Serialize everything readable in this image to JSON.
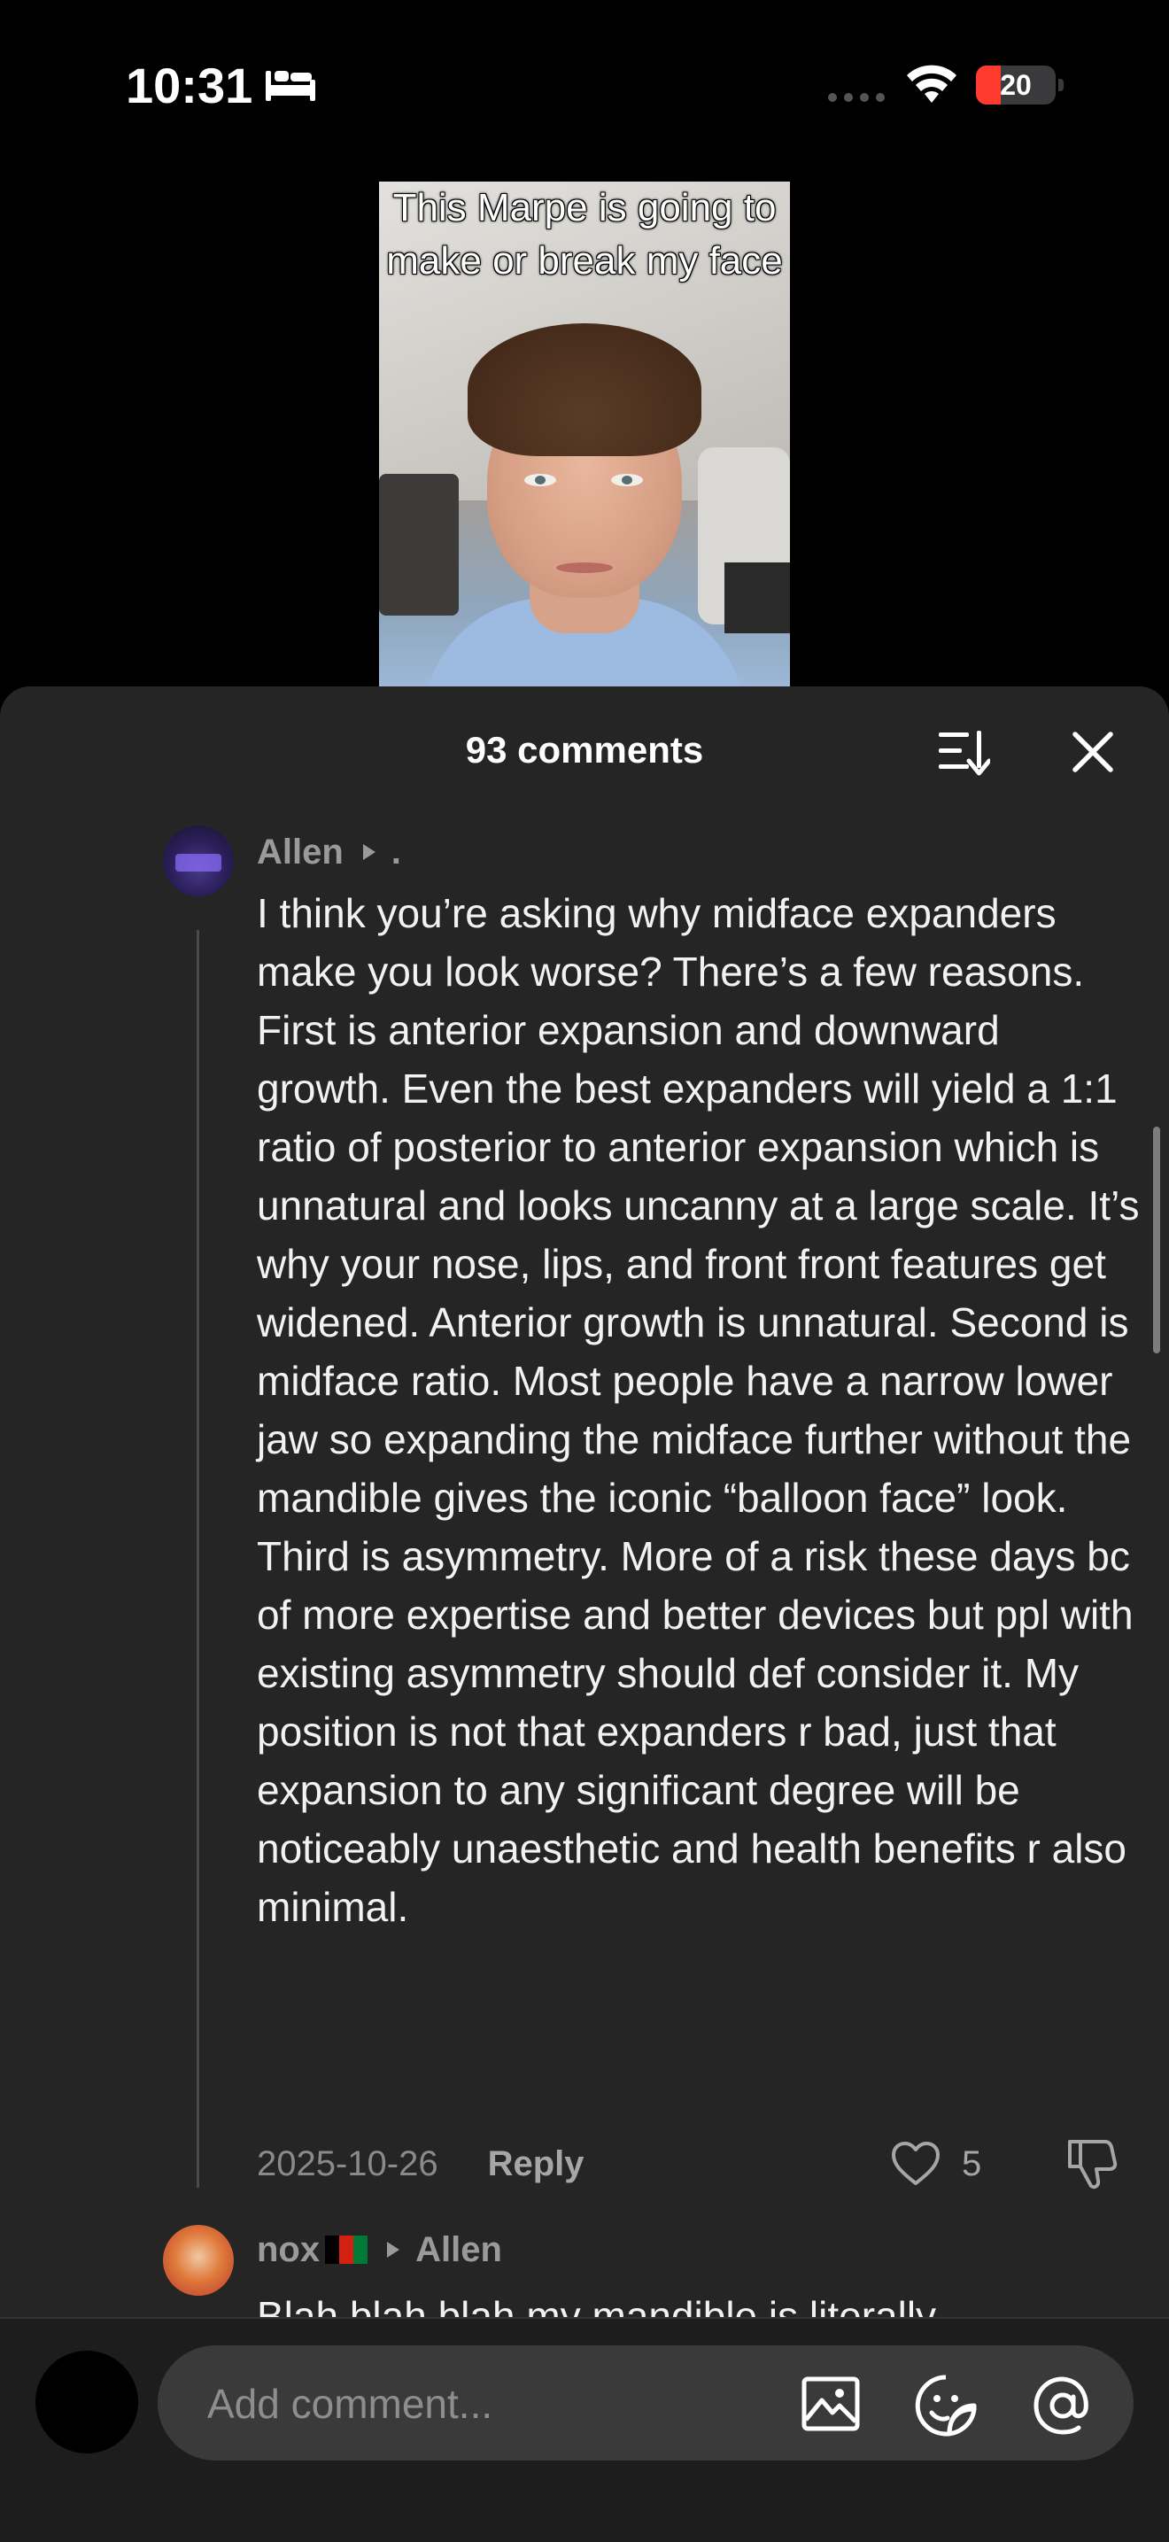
{
  "status_bar": {
    "time": "10:31",
    "battery_level": "20",
    "battery_color": "#ff3b30",
    "icons": [
      "bed-icon",
      "signal-dots-icon",
      "wifi-icon",
      "battery-icon"
    ]
  },
  "video": {
    "caption": "This Marpe is going to make or break my face"
  },
  "comments_sheet": {
    "title": "93 comments",
    "header_icons": [
      "sort-icon",
      "close-icon"
    ],
    "comment": {
      "username": "Allen",
      "username_suffix": ".",
      "body": "I think you’re asking why midface expanders make you look worse? There’s a few reasons. First is anterior expansion and downward growth. Even the best expanders will yield a 1:1 ratio of posterior to anterior expansion which is unnatural and looks uncanny at a large scale. It’s why your nose, lips, and front front features get widened. Anterior growth is unnatural. Second is midface ratio. Most people have a narrow lower jaw so expanding the midface further without the mandible gives the iconic “balloon face” look. Third is asymmetry. More of a risk these days bc of more expertise and better devices but ppl with existing asymmetry should def consider it. My position is not that expanders r bad, just that expansion to any significant degree will be noticeably unaesthetic and health benefits r also minimal.",
      "date": "2025-10-26",
      "reply_label": "Reply",
      "like_count": "5"
    },
    "reply": {
      "username": "nox",
      "reply_to": "Allen",
      "preview": "Blah blah blah my mandible is literally"
    }
  },
  "input_bar": {
    "placeholder": "Add comment...",
    "icons": [
      "image-icon",
      "sticker-icon",
      "at-icon"
    ]
  }
}
